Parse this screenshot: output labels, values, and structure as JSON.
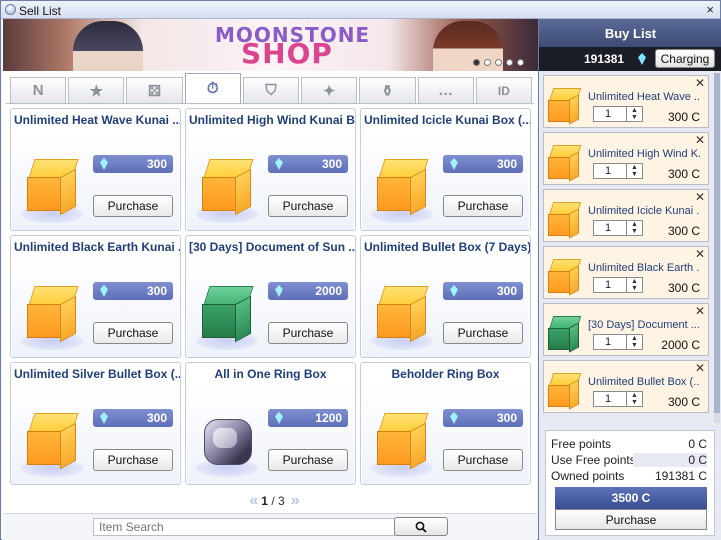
{
  "window": {
    "title": "Sell List",
    "close_label": "×"
  },
  "banner": {
    "logo_top": "MOONSTONE",
    "logo_bottom": "SHOP"
  },
  "tabs": [
    {
      "label": "N",
      "icon": "new-icon"
    },
    {
      "label": "★",
      "icon": "star-icon"
    },
    {
      "label": "⚄",
      "icon": "hourglass-box-icon"
    },
    {
      "label": "⏱",
      "icon": "clock-icon"
    },
    {
      "label": "⛉",
      "icon": "shield-icon"
    },
    {
      "label": "✦",
      "icon": "sparkle-icon"
    },
    {
      "label": "⚱",
      "icon": "potion-icon"
    },
    {
      "label": "…",
      "icon": "chat-icon"
    },
    {
      "label": "ID",
      "icon": "id-card-icon"
    }
  ],
  "items": [
    {
      "name": "Unlimited Heat Wave Kunai ...",
      "price": "300",
      "buy": "Purchase",
      "kind": "gold"
    },
    {
      "name": "Unlimited High Wind Kunai B...",
      "price": "300",
      "buy": "Purchase",
      "kind": "gold"
    },
    {
      "name": "Unlimited Icicle Kunai Box (...",
      "price": "300",
      "buy": "Purchase",
      "kind": "gold"
    },
    {
      "name": "Unlimited Black Earth Kunai ...",
      "price": "300",
      "buy": "Purchase",
      "kind": "gold"
    },
    {
      "name": "[30 Days] Document of Sun ...",
      "price": "2000",
      "buy": "Purchase",
      "kind": "green"
    },
    {
      "name": "Unlimited Bullet Box (7 Days)",
      "price": "300",
      "buy": "Purchase",
      "kind": "gold"
    },
    {
      "name": "Unlimited Silver Bullet Box (...",
      "price": "300",
      "buy": "Purchase",
      "kind": "gold"
    },
    {
      "name": "All in One Ring Box",
      "price": "1200",
      "buy": "Purchase",
      "kind": "ring"
    },
    {
      "name": "Beholder Ring Box",
      "price": "300",
      "buy": "Purchase",
      "kind": "gold"
    }
  ],
  "pagination": {
    "prev": "«",
    "next": "»",
    "current": "1",
    "separator": " / ",
    "total": "3"
  },
  "search": {
    "placeholder": "Item Search"
  },
  "buy_list": {
    "title": "Buy List",
    "balance": "191381",
    "charging_label": "Charging",
    "items": [
      {
        "name": "Unlimited Heat Wave ...",
        "qty": "1",
        "price": "300 C",
        "kind": "gold"
      },
      {
        "name": "Unlimited High Wind K...",
        "qty": "1",
        "price": "300 C",
        "kind": "gold"
      },
      {
        "name": "Unlimited Icicle Kunai ...",
        "qty": "1",
        "price": "300 C",
        "kind": "gold"
      },
      {
        "name": "Unlimited Black Earth ...",
        "qty": "1",
        "price": "300 C",
        "kind": "gold"
      },
      {
        "name": "[30 Days] Document ...",
        "qty": "1",
        "price": "2000 C",
        "kind": "green"
      },
      {
        "name": "Unlimited Bullet Box (...",
        "qty": "1",
        "price": "300 C",
        "kind": "gold"
      }
    ]
  },
  "summary": {
    "free_points_label": "Free points",
    "free_points": "0 C",
    "use_free_label": "Use Free points",
    "use_free": "0 C",
    "owned_label": "Owned points",
    "owned": "191381 C",
    "total": "3500 C",
    "purchase_label": "Purchase"
  }
}
